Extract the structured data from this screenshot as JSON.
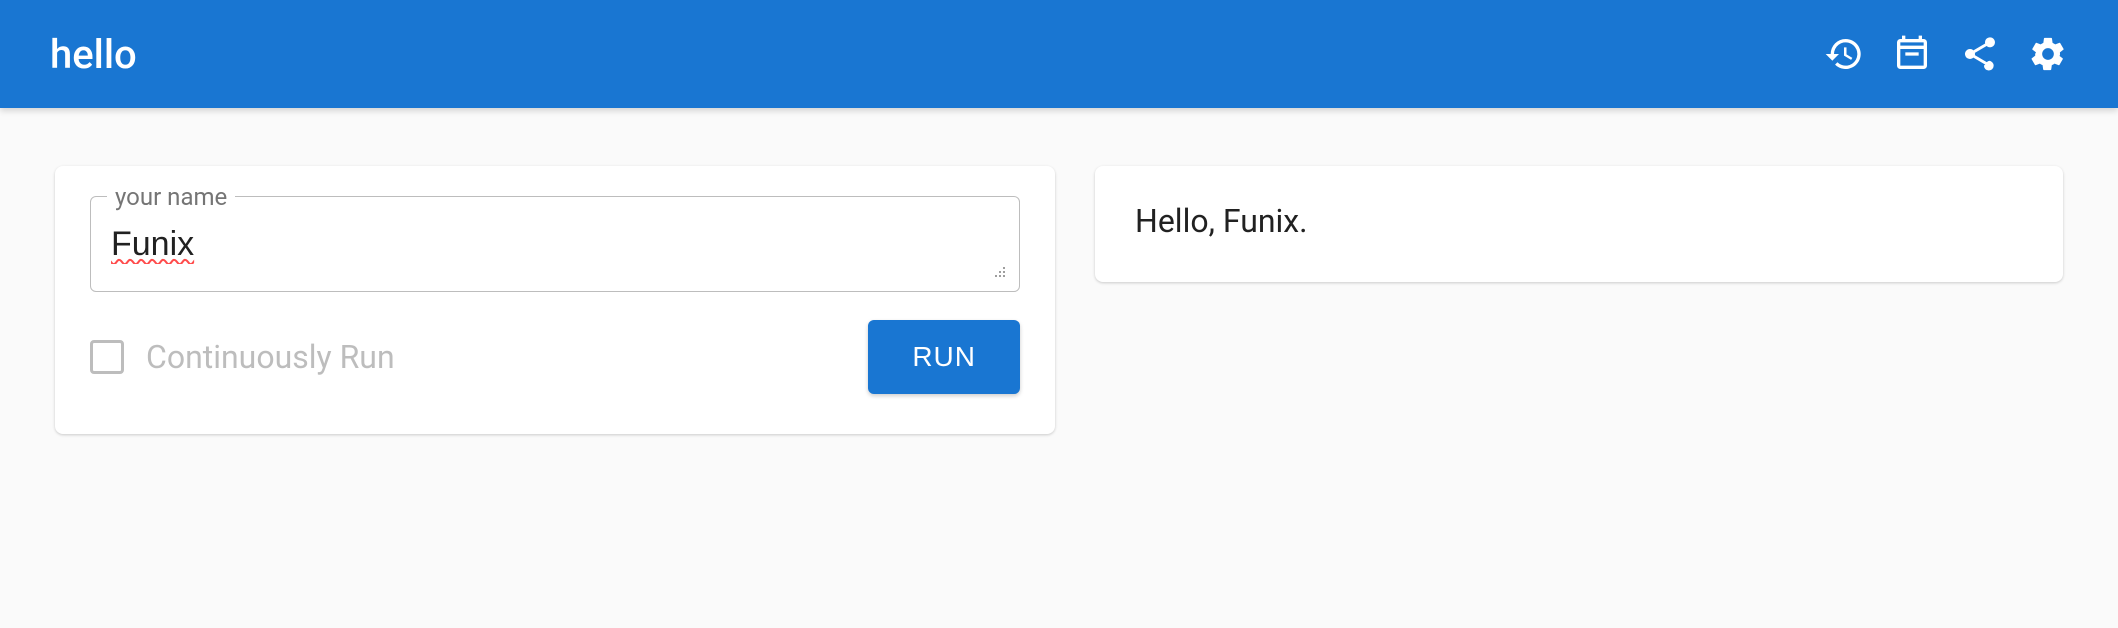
{
  "header": {
    "title": "hello"
  },
  "input": {
    "name_label": "your name",
    "name_value": "Funix",
    "continuously_run_label": "Continuously Run",
    "continuously_run_checked": false,
    "run_button_label": "RUN"
  },
  "output": {
    "text": "Hello, Funix."
  }
}
